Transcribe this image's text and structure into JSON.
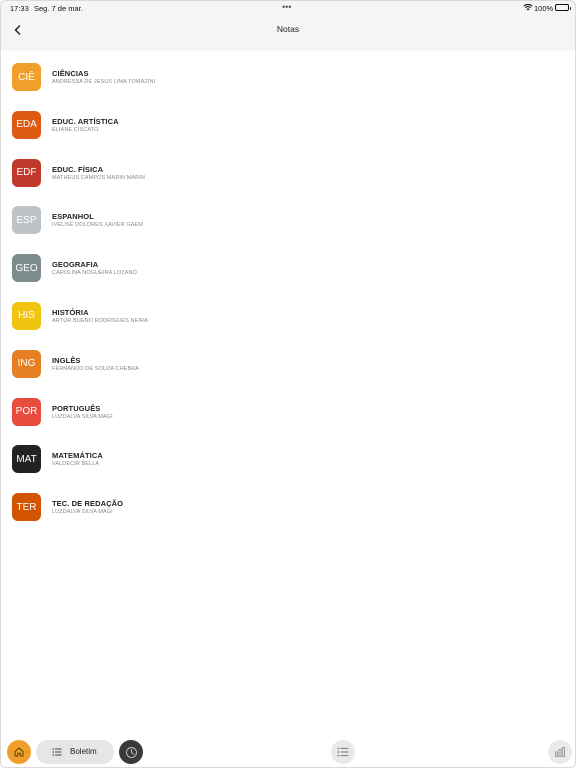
{
  "status_bar": {
    "time": "17:33",
    "date": "Seg. 7 de mar.",
    "dots": "•••",
    "battery": "100%"
  },
  "nav": {
    "title": "Notas",
    "back_icon": "chevron-left-icon"
  },
  "subjects": [
    {
      "code": "CIÊ",
      "name": "CIÊNCIAS",
      "teacher": "ANDRESSA DE JESUS LIMA TOMAZINI",
      "color": "#f0a02a"
    },
    {
      "code": "EDA",
      "name": "EDUC. ARTÍSTICA",
      "teacher": "ELIANE CISCATO",
      "color": "#dd5a12"
    },
    {
      "code": "EDF",
      "name": "EDUC. FÍSICA",
      "teacher": "MATHEUS CAMPOS MARIN MARIN",
      "color": "#c0392b"
    },
    {
      "code": "ESP",
      "name": "ESPANHOL",
      "teacher": "IVELISE DOLORES XAVIER GAEM",
      "color": "#bdc3c7"
    },
    {
      "code": "GEO",
      "name": "GEOGRAFIA",
      "teacher": "CAROLINA NOGUEIRA LOZANO",
      "color": "#7f8c8d"
    },
    {
      "code": "HIS",
      "name": "HISTÓRIA",
      "teacher": "ARTUR BUENO RODRIGUES NEIRA",
      "color": "#f1c40f"
    },
    {
      "code": "ING",
      "name": "INGLÊS",
      "teacher": "FERNANDO DE SOUZA CHEBRA",
      "color": "#e67e22"
    },
    {
      "code": "POR",
      "name": "PORTUGUÊS",
      "teacher": "LUZDALVA SILVA MAGI",
      "color": "#e74c3c"
    },
    {
      "code": "MAT",
      "name": "MATEMÁTICA",
      "teacher": "VALDECIR BELLA",
      "color": "#222222"
    },
    {
      "code": "TER",
      "name": "TEC. DE REDAÇÃO",
      "teacher": "LUZDALVA SILVA MAGI",
      "color": "#d35400"
    }
  ],
  "tab_bar": {
    "home_icon": "home-icon",
    "pill_label": "Boletim",
    "pill_icon": "list-icon",
    "clock_icon": "clock-icon",
    "list_icon": "list-icon",
    "chart_icon": "bar-chart-icon",
    "accent": "#f0a02a"
  }
}
